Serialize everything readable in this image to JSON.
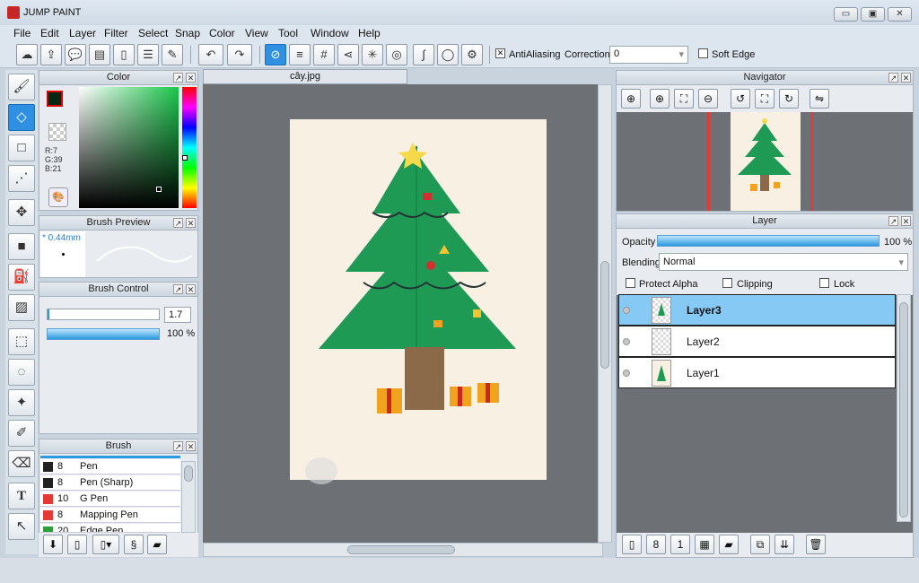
{
  "app": {
    "title": "JUMP PAINT"
  },
  "window_controls": {
    "minimize": "▭",
    "restore": "▣",
    "close": "✕"
  },
  "menu": [
    "File",
    "Edit",
    "Layer",
    "Filter",
    "Select",
    "Snap",
    "Color",
    "View",
    "Tool",
    "Window",
    "Help"
  ],
  "toolbar": {
    "antialiasing_label": "AntiAliasing",
    "correction_label": "Correction",
    "correction_value": "0",
    "soft_edge_label": "Soft Edge"
  },
  "color_panel": {
    "title": "Color",
    "r": "R:7",
    "g": "G:39",
    "b": "B:21",
    "fg_color": "#072715"
  },
  "brush_preview": {
    "title": "Brush Preview",
    "size": "* 0.44mm"
  },
  "brush_control": {
    "title": "Brush Control",
    "size_value": "1.7",
    "opacity_value": "100 %"
  },
  "brush_panel": {
    "title": "Brush",
    "items": [
      {
        "size": "8",
        "name": "Pen",
        "color": "#222222"
      },
      {
        "size": "8",
        "name": "Pen (Sharp)",
        "color": "#222222"
      },
      {
        "size": "10",
        "name": "G Pen",
        "color": "#e53935"
      },
      {
        "size": "8",
        "name": "Mapping Pen",
        "color": "#e53935"
      },
      {
        "size": "20",
        "name": "Edge Pen",
        "color": "#2e9e3a"
      }
    ]
  },
  "document": {
    "tab": "cây.jpg"
  },
  "navigator": {
    "title": "Navigator"
  },
  "layer_panel": {
    "title": "Layer",
    "opacity_label": "Opacity",
    "opacity_value": "100 %",
    "blending_label": "Blending",
    "blending_value": "Normal",
    "protect_alpha": "Protect Alpha",
    "clipping": "Clipping",
    "lock": "Lock",
    "layers": [
      {
        "name": "Layer3",
        "selected": true
      },
      {
        "name": "Layer2",
        "selected": false
      },
      {
        "name": "Layer1",
        "selected": false
      }
    ]
  }
}
